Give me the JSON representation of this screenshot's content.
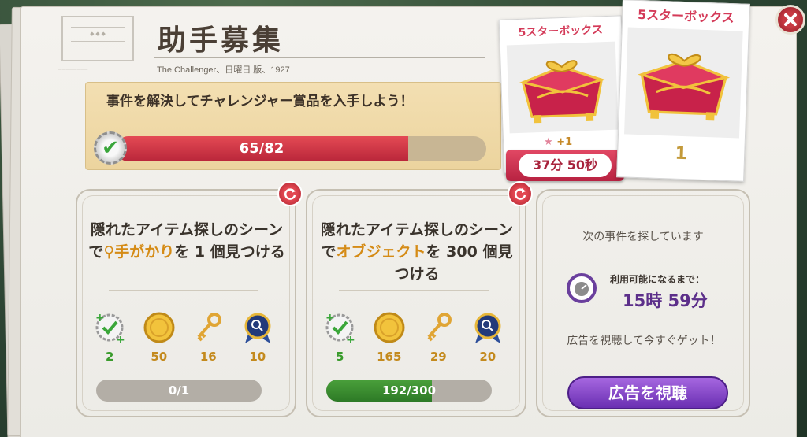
{
  "header": {
    "title": "助手募集",
    "subtitle": "The Challenger、日曜日 版、1927"
  },
  "goal": {
    "text": "事件を解決してチャレンジャー賞品を入手しよう！",
    "progress_text": "65/82",
    "progress": 0.79
  },
  "reward_cards": [
    {
      "title": "5スターボックス",
      "star_bonus": "+1",
      "timer": "37分 50秒"
    },
    {
      "title": "5スターボックス",
      "count": "1"
    }
  ],
  "tasks": [
    {
      "text_before": "隠れたアイテム探しのシーンで",
      "highlight": "手がかり",
      "text_after": "を 1 個見つける",
      "rewards": [
        {
          "icon": "green-check-icon",
          "value": "2"
        },
        {
          "icon": "gold-coin-icon",
          "value": "50"
        },
        {
          "icon": "energy-key-icon",
          "value": "16"
        },
        {
          "icon": "magnifier-medal-icon",
          "value": "10"
        }
      ],
      "progress_text": "0/1",
      "progress": 0
    },
    {
      "text_before": "隠れたアイテム探しのシーンで",
      "highlight": "オブジェクト",
      "text_after": "を 300 個見つける",
      "rewards": [
        {
          "icon": "green-check-icon",
          "value": "5"
        },
        {
          "icon": "gold-coin-icon",
          "value": "165"
        },
        {
          "icon": "energy-key-icon",
          "value": "29"
        },
        {
          "icon": "magnifier-medal-icon",
          "value": "20"
        }
      ],
      "progress_text": "192/300",
      "progress": 0.64
    }
  ],
  "next_case": {
    "status": "次の事件を探しています",
    "available_label": "利用可能になるまで：",
    "available_time": "15時 59分",
    "watch_text": "広告を視聴して今すぐゲット！",
    "watch_button": "広告を視聴"
  },
  "colors": {
    "accent_red": "#d43a58",
    "progress_red": "#c22c40",
    "progress_green": "#3a8d2f",
    "button_purple": "#8346c9",
    "highlight_gold": "#d58b16"
  }
}
